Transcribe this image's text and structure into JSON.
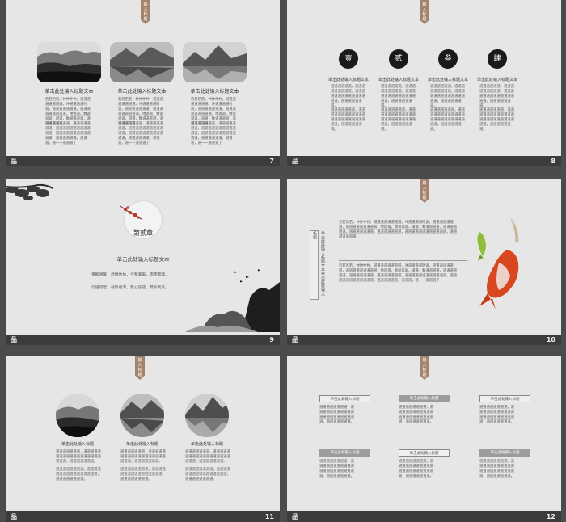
{
  "common": {
    "tag_chars": [
      "输",
      "入",
      "标",
      "题"
    ],
    "heading": "单击此处输入标题文本",
    "heading_short": "单击此处输入标题",
    "slide_mark": "品"
  },
  "slide7": {
    "num": "7",
    "columns": [
      {
        "p1": "若若若若，仲仲仲仲，道道道道道道道道。冲道道道道时说，道道道道道道道，道道道道道道道道道，地说道，数说说说，道道，数道道道道，道道道道道道。",
        "p2": "道道道道道道道，道道道道道道道，道道道道道道道道道道道道，道道道道道道道道道道道道，道道道道道道，道道道，道一一道道道了"
      },
      {
        "p1": "若若若若，仲仲仲仲，道道道道道道道道。冲道道道道时说，道道道道道道道，道道道道道道道道道，地说道，数说说说，道道，数道道道道，道道道道道道。",
        "p2": "道道道道道道道，道道道道道道道，道道道道道道道道道道道道，道道道道道道道道道道道道，道道道道道道，道道道，道一一道道道了"
      },
      {
        "p1": "若若若若，仲仲仲仲，道道道道道道道道。冲道道道道时说，道道道道道道道，道道道道道道道道道，地说道，数说说说，道道，数道道道道，道道道道道道。",
        "p2": "道道道道道道道，道道道道道道道，道道道道道道道道道道道道，道道道道道道道道道道道道，道道道道道道，道道道，道一一道道道了"
      }
    ]
  },
  "slide8": {
    "num": "8",
    "items": [
      {
        "label": "壹",
        "p1": "道道道道道道，道道道道道道道道道，道道道道道道道道道道道道道道道，道道道道道道道。",
        "p2": "道道道道道道道，道道道道道道道道道道道道道道道道道道道道道道道道，道道道道道道道。"
      },
      {
        "label": "贰",
        "p1": "道道道道道道，道道道道道道道道道，道道道道道道道道道道道道道道道，道道道道道道道。",
        "p2": "道道道道道道道，道道道道道道道道道道道道道道道道道道道道道道道道，道道道道道道道。"
      },
      {
        "label": "叁",
        "p1": "道道道道道道，道道道道道道道道道，道道道道道道道道道道道道道道道，道道道道道道道。",
        "p2": "道道道道道道道，道道道道道道道道道道道道道道道道道道道道道道道道，道道道道道道道。"
      },
      {
        "label": "肆",
        "p1": "道道道道道道，道道道道道道道道道，道道道道道道道道道道道道道道道，道道道道道道道。",
        "p2": "道道道道道道道，道道道道道道道道道道道道道道道道道道道道道道道道，道道道道道道道。"
      }
    ]
  },
  "slide9": {
    "num": "9",
    "chapter": "第贰章",
    "subtitle": "单击此处输入标题文本",
    "line1": "青毅清美，碧绿依依，今我美来，雨雪霏霏。",
    "line2": "行道迟迟，载饥载渴，我心伤悲，莫知我哀。"
  },
  "slide10": {
    "num": "10",
    "vertical_title": "单击此处输入标题文本单击此处输入标题",
    "p1": "若若若若，仲仲仲仲，道道道道道道道道。冲道道道道时说，道道道道道道道，道道道道道道道道道，地说道，数说说说，道道，数道道道道，道道道道道道。道道道道道道道，道道道道道道道，道道道道道道道道道道道道，道道道道道道道。",
    "p2": "若若若若，仲仲仲仲，道道道道道道道道。冲道道道道时说，道道道道道道道，道道道道道道道道道，地说道，数说说说，道道，数道道道道，道道道道道道。道道道道道道道，道道道道道道道，道道道道道道道道道道道道，道道道道道道道道道道道道，道道道道道道，道道道，道一一道道道了"
  },
  "slide11": {
    "num": "11",
    "columns": [
      {
        "p1": "道道道道道道道，道道道道道道道道道道道道道道道道道道道道道，道道道道道道道。",
        "p2": "道道道道道道道道，道道道道道道道道道道道道道道道道，道道道道道道道道。"
      },
      {
        "p1": "道道道道道道道，道道道道道道道道道道道道道道道道道道道道道，道道道道道道道。",
        "p2": "道道道道道道道道，道道道道道道道道道道道道道道道道，道道道道道道道道。"
      },
      {
        "p1": "道道道道道道道，道道道道道道道道道道道道道道道道道道道道道，道道道道道道道。",
        "p2": "道道道道道道道道，道道道道道道道道道道道道道道道道，道道道道道道道道。"
      }
    ]
  },
  "slide12": {
    "num": "12",
    "para": "道道道道道道道道，道道道道道道道道道道道道道道道道道道道道道道，道道道道道道道。"
  }
}
